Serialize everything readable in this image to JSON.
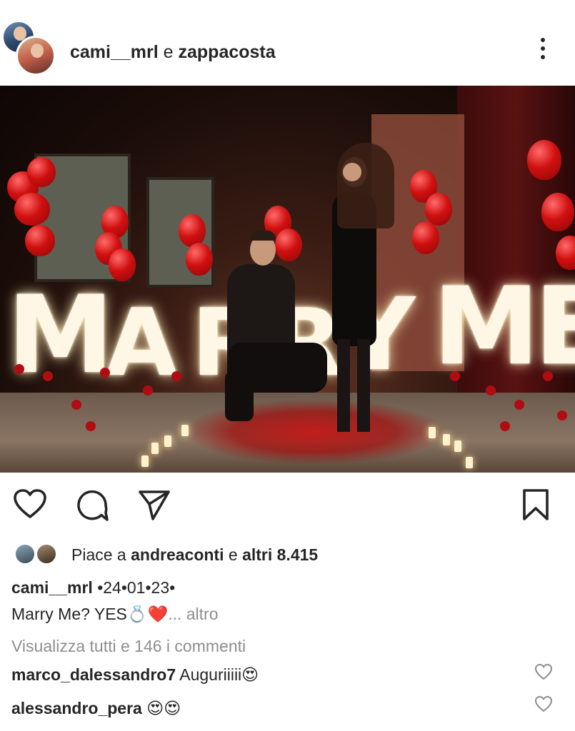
{
  "header": {
    "usernames": "cami__mrl",
    "joiner": " e ",
    "second_user": "zappacosta",
    "more_icon": "more-vertical-icon"
  },
  "post": {
    "photo_letters": [
      "M",
      "A",
      "R",
      "R",
      "Y",
      "M",
      "E"
    ]
  },
  "actions": {
    "like_icon": "heart-outline-icon",
    "comment_icon": "comment-bubble-icon",
    "share_icon": "paper-plane-icon",
    "save_icon": "bookmark-icon"
  },
  "likes": {
    "prefix": "Piace a ",
    "user": "andreaconti",
    "middle": " e ",
    "others": "altri 8.415"
  },
  "caption": {
    "user": "cami__mrl",
    "date": " •24•01•23•",
    "text": "Marry Me? YES💍❤️",
    "more": "... altro"
  },
  "view_comments": "Visualizza tutti e 146 i commenti",
  "comments": [
    {
      "user": "marco_dalessandro7",
      "text": " Auguriiiii😍"
    },
    {
      "user": "alessandro_pera",
      "text": " 😍😍"
    }
  ],
  "colors": {
    "text": "#262626",
    "muted": "#8e8e8e",
    "heart_red": "#e8151a"
  }
}
